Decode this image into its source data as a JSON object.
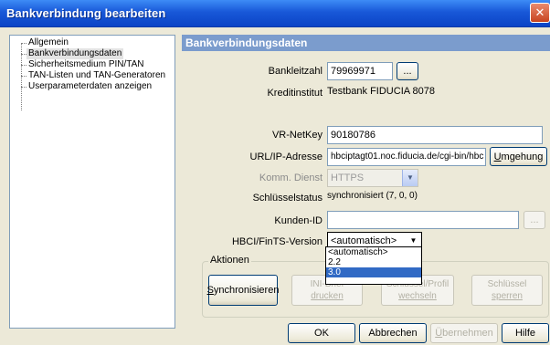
{
  "window": {
    "title": "Bankverbindung bearbeiten",
    "close_glyph": "✕"
  },
  "sidebar": {
    "items": [
      {
        "label": "Allgemein"
      },
      {
        "label": "Bankverbindungsdaten"
      },
      {
        "label": "Sicherheitsmedium PIN/TAN"
      },
      {
        "label": "TAN-Listen und TAN-Generatoren"
      },
      {
        "label": "Userparameterdaten anzeigen"
      }
    ]
  },
  "section": {
    "title": "Bankverbindungsdaten"
  },
  "form": {
    "bankleitzahl": {
      "label": "Bankleitzahl",
      "value": "79969971",
      "browse": "..."
    },
    "kreditinstitut": {
      "label": "Kreditinstitut",
      "value": "Testbank FIDUCIA 8078"
    },
    "vrnetkey": {
      "label": "VR-NetKey",
      "value": "90180786"
    },
    "url": {
      "label": "URL/IP-Adresse",
      "value": "hbciptagt01.noc.fiducia.de/cgi-bin/hbc",
      "button_u": "U",
      "button_rest": "mgehung"
    },
    "komm": {
      "label": "Komm. Dienst",
      "value": "HTTPS"
    },
    "schluesselstatus": {
      "label": "Schlüsselstatus",
      "value": "synchronisiert (7, 0, 0)"
    },
    "kunden_id": {
      "label": "Kunden-ID",
      "value": "",
      "browse": "..."
    },
    "hbci": {
      "label": "HBCI/FinTS-Version",
      "value": "<automatisch>",
      "options": [
        "<automatisch>",
        "2.2",
        "3.0"
      ],
      "highlighted": "3.0"
    }
  },
  "actions": {
    "group_title": "Aktionen",
    "sync_u": "S",
    "sync_rest": "ynchronisieren",
    "ini_line1": "INI-Brief",
    "ini_line2": "drucken",
    "profil_line1": "Schlüssel/Profil",
    "profil_line2": "wechseln",
    "sperren_line1": "Schlüssel",
    "sperren_line2": "sperren"
  },
  "footer": {
    "ok": "OK",
    "abbrechen": "Abbrechen",
    "uebernehmen_u": "Ü",
    "uebernehmen_rest": "bernehmen",
    "hilfe": "Hilfe"
  }
}
